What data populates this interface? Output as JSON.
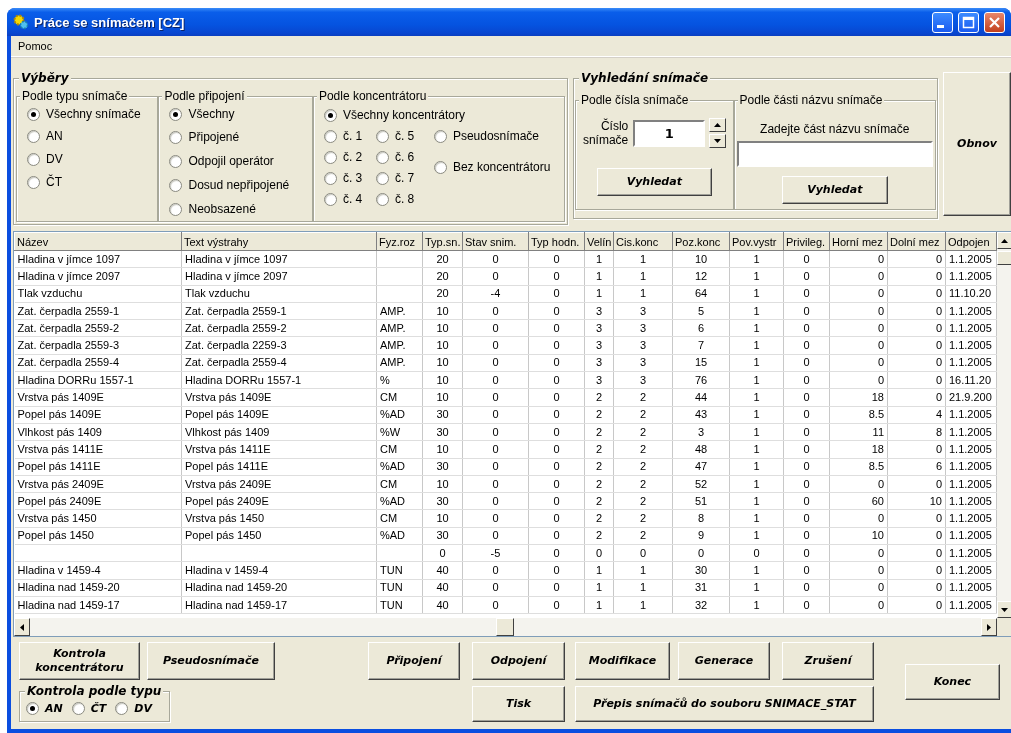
{
  "window": {
    "title": "Práce se snímačem [CZ]"
  },
  "menu": [
    "Pomoc"
  ],
  "selections": {
    "title": "Výběry",
    "groups": [
      {
        "title": "Podle typu snímače",
        "options": [
          {
            "label": "Všechny snímače",
            "selected": true
          },
          {
            "label": "AN",
            "selected": false
          },
          {
            "label": "DV",
            "selected": false
          },
          {
            "label": "ČT",
            "selected": false
          }
        ]
      },
      {
        "title": "Podle připojení",
        "options": [
          {
            "label": "Všechny",
            "selected": true
          },
          {
            "label": "Připojené",
            "selected": false
          },
          {
            "label": "Odpojil operátor",
            "selected": false
          },
          {
            "label": "Dosud nepřipojené",
            "selected": false
          },
          {
            "label": "Neobsazené",
            "selected": false
          }
        ]
      },
      {
        "title": "Podle koncentrátoru",
        "options": [
          {
            "label": "Všechny koncentrátory",
            "selected": true
          },
          {
            "label": "č. 1",
            "selected": false
          },
          {
            "label": "č. 2",
            "selected": false
          },
          {
            "label": "č. 3",
            "selected": false
          },
          {
            "label": "č. 4",
            "selected": false
          },
          {
            "label": "č. 5",
            "selected": false
          },
          {
            "label": "č. 6",
            "selected": false
          },
          {
            "label": "č. 7",
            "selected": false
          },
          {
            "label": "č. 8",
            "selected": false
          },
          {
            "label": "Pseudosnímače",
            "selected": false
          },
          {
            "label": "Bez koncentrátoru",
            "selected": false
          }
        ]
      }
    ]
  },
  "search": {
    "title": "Vyhledání snímače",
    "by_number": {
      "title": "Podle čísla snímače",
      "label": "Číslo snímače",
      "value": "1",
      "button": "Vyhledat"
    },
    "by_name": {
      "title": "Podle části názvu snímače",
      "label": "Zadejte část názvu snímače",
      "button": "Vyhledat"
    }
  },
  "refresh_button": "Obnov",
  "table": {
    "columns": [
      "Název",
      "Text výstrahy",
      "Fyz.roz",
      "Typ.sn.",
      "Stav snim.",
      "Typ hodn.",
      "Velín",
      "Cis.konc",
      "Poz.konc",
      "Pov.vystr",
      "Privileg.",
      "Horní mez",
      "Dolní mez",
      "Odpojen"
    ],
    "rows": [
      [
        "Hladina v jímce 1097",
        "Hladina v jímce 1097",
        null,
        "20",
        "0",
        "0",
        "1",
        "1",
        "10",
        "1",
        "0",
        "0",
        "0",
        "1.1.2005"
      ],
      [
        "Hladina v jímce 2097",
        "Hladina v jímce 2097",
        null,
        "20",
        "0",
        "0",
        "1",
        "1",
        "12",
        "1",
        "0",
        "0",
        "0",
        "1.1.2005"
      ],
      [
        "Tlak vzduchu",
        "Tlak vzduchu",
        null,
        "20",
        "-4",
        "0",
        "1",
        "1",
        "64",
        "1",
        "0",
        "0",
        "0",
        "11.10.20"
      ],
      [
        "Zat. čerpadla 2559-1",
        "Zat. čerpadla 2559-1",
        "AMP.",
        "10",
        "0",
        "0",
        "3",
        "3",
        "5",
        "1",
        "0",
        "0",
        "0",
        "1.1.2005"
      ],
      [
        "Zat. čerpadla 2559-2",
        "Zat. čerpadla 2559-2",
        "AMP.",
        "10",
        "0",
        "0",
        "3",
        "3",
        "6",
        "1",
        "0",
        "0",
        "0",
        "1.1.2005"
      ],
      [
        "Zat. čerpadla 2559-3",
        "Zat. čerpadla 2259-3",
        "AMP.",
        "10",
        "0",
        "0",
        "3",
        "3",
        "7",
        "1",
        "0",
        "0",
        "0",
        "1.1.2005"
      ],
      [
        "Zat. čerpadla 2559-4",
        "Zat. čerpadla 2559-4",
        "AMP.",
        "10",
        "0",
        "0",
        "3",
        "3",
        "15",
        "1",
        "0",
        "0",
        "0",
        "1.1.2005"
      ],
      [
        "Hladina DORRu 1557-1",
        "Hladina DORRu 1557-1",
        "%",
        "10",
        "0",
        "0",
        "3",
        "3",
        "76",
        "1",
        "0",
        "0",
        "0",
        "16.11.20"
      ],
      [
        "Vrstva pás 1409E",
        "Vrstva pás 1409E",
        "CM",
        "10",
        "0",
        "0",
        "2",
        "2",
        "44",
        "1",
        "0",
        "18",
        "0",
        "21.9.200"
      ],
      [
        "Popel pás 1409E",
        "Popel pás 1409E",
        "%AD",
        "30",
        "0",
        "0",
        "2",
        "2",
        "43",
        "1",
        "0",
        "8.5",
        "4",
        "1.1.2005"
      ],
      [
        "Vlhkost pás 1409",
        "Vlhkost pás 1409",
        "%W",
        "30",
        "0",
        "0",
        "2",
        "2",
        "3",
        "1",
        "0",
        "11",
        "8",
        "1.1.2005"
      ],
      [
        "Vrstva pás 1411E",
        "Vrstva pás 1411E",
        "CM",
        "10",
        "0",
        "0",
        "2",
        "2",
        "48",
        "1",
        "0",
        "18",
        "0",
        "1.1.2005"
      ],
      [
        "Popel pás 1411E",
        "Popel pás 1411E",
        "%AD",
        "30",
        "0",
        "0",
        "2",
        "2",
        "47",
        "1",
        "0",
        "8.5",
        "6",
        "1.1.2005"
      ],
      [
        "Vrstva pás 2409E",
        "Vrstva pás 2409E",
        "CM",
        "10",
        "0",
        "0",
        "2",
        "2",
        "52",
        "1",
        "0",
        "0",
        "0",
        "1.1.2005"
      ],
      [
        "Popel pás 2409E",
        "Popel pás 2409E",
        "%AD",
        "30",
        "0",
        "0",
        "2",
        "2",
        "51",
        "1",
        "0",
        "60",
        "10",
        "1.1.2005"
      ],
      [
        "Vrstva pás 1450",
        "Vrstva pás 1450",
        "CM",
        "10",
        "0",
        "0",
        "2",
        "2",
        "8",
        "1",
        "0",
        "0",
        "0",
        "1.1.2005"
      ],
      [
        "Popel pás 1450",
        "Popel pás 1450",
        "%AD",
        "30",
        "0",
        "0",
        "2",
        "2",
        "9",
        "1",
        "0",
        "10",
        "0",
        "1.1.2005"
      ],
      [
        null,
        null,
        null,
        "0",
        "-5",
        "0",
        "0",
        "0",
        "0",
        "0",
        "0",
        "0",
        "0",
        "1.1.2005"
      ],
      [
        "Hladina v 1459-4",
        "Hladina v 1459-4",
        "TUN",
        "40",
        "0",
        "0",
        "1",
        "1",
        "30",
        "1",
        "0",
        "0",
        "0",
        "1.1.2005"
      ],
      [
        "Hladina nad 1459-20",
        "Hladina nad 1459-20",
        "TUN",
        "40",
        "0",
        "0",
        "1",
        "1",
        "31",
        "1",
        "0",
        "0",
        "0",
        "1.1.2005"
      ],
      [
        "Hladina nad 1459-17",
        "Hladina nad 1459-17",
        "TUN",
        "40",
        "0",
        "0",
        "1",
        "1",
        "32",
        "1",
        "0",
        "0",
        "0",
        "1.1.2005"
      ]
    ]
  },
  "buttons": [
    "Kontrola koncentrátoru",
    "Pseudosnímače",
    "Připojení",
    "Odpojení",
    "Modifikace",
    "Generace",
    "Zrušení",
    "Tisk",
    "Přepis snímačů do souboru SNIMACE_STAT",
    "Konec"
  ],
  "type_check": {
    "title": "Kontrola podle typu",
    "options": [
      {
        "label": "AN",
        "selected": true
      },
      {
        "label": "ČT",
        "selected": false
      },
      {
        "label": "DV",
        "selected": false
      }
    ]
  }
}
